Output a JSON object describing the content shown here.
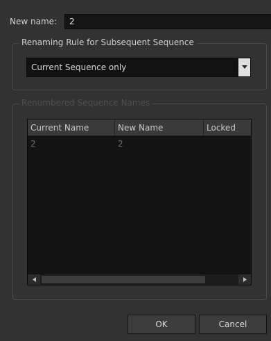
{
  "dialog": {
    "new_name_label": "New name:",
    "new_name_value": "2"
  },
  "renaming_rule": {
    "title": "Renaming Rule for Subsequent Sequence",
    "selected": "Current Sequence only"
  },
  "renumbered": {
    "title": "Renumbered Sequence Names",
    "columns": [
      "Current Name",
      "New Name",
      "Locked"
    ],
    "rows": [
      {
        "current": "2",
        "new": "2",
        "locked": ""
      }
    ]
  },
  "buttons": {
    "ok": "OK",
    "cancel": "Cancel"
  },
  "colors": {
    "background": "#323232",
    "field": "#141414",
    "disabled_text": "#4e4e4e"
  },
  "icons": {
    "dropdown": "chevron-down-icon",
    "scroll_left": "arrow-left-icon",
    "scroll_right": "arrow-right-icon"
  }
}
